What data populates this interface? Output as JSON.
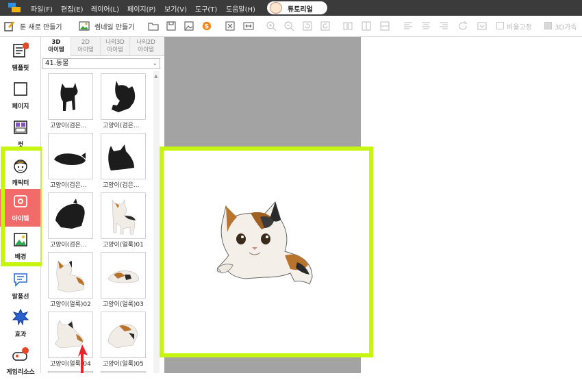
{
  "menubar": {
    "items": [
      "파일(F)",
      "편집(E)",
      "레이어(L)",
      "페이지(P)",
      "보기(V)",
      "도구(T)",
      "도움말(H)"
    ],
    "tutorial_label": "튜토리얼"
  },
  "toolbar": {
    "new_label": "툰 새로 만들기",
    "thumbnail_label": "썸네일 만들기",
    "ratio_lock_label": "비율고정",
    "accel_3d_label": "3D가속"
  },
  "leftnav": {
    "items": [
      {
        "label": "템플릿",
        "icon": "template-icon"
      },
      {
        "label": "페이지",
        "icon": "page-icon"
      },
      {
        "label": "컷",
        "icon": "cut-icon"
      },
      {
        "label": "캐릭터",
        "icon": "character-icon"
      },
      {
        "label": "아이템",
        "icon": "item-icon"
      },
      {
        "label": "배경",
        "icon": "background-icon"
      },
      {
        "label": "말풍선",
        "icon": "speech-bubble-icon"
      },
      {
        "label": "효과",
        "icon": "effect-icon"
      },
      {
        "label": "게임리소스",
        "icon": "game-resource-icon"
      }
    ],
    "active": "아이템",
    "highlight_color": "#c6f510",
    "active_color": "#f26b6b"
  },
  "panel": {
    "tabs": [
      {
        "line1": "3D",
        "line2": "아이템"
      },
      {
        "line1": "2D",
        "line2": "아이템"
      },
      {
        "line1": "나의3D",
        "line2": "아이템"
      },
      {
        "line1": "나의2D",
        "line2": "아이템"
      }
    ],
    "category": "41.동물",
    "items": [
      {
        "caption": "고양이(검은..."
      },
      {
        "caption": "고양이(검은..."
      },
      {
        "caption": "고양이(검은..."
      },
      {
        "caption": "고양이(검은..."
      },
      {
        "caption": "고양이(검은..."
      },
      {
        "caption": "고양이(얼룩)01"
      },
      {
        "caption": "고양이(얼룩)02"
      },
      {
        "caption": "고양이(얼룩)03"
      },
      {
        "caption": "고양이(얼룩)04"
      },
      {
        "caption": "고양이(얼룩)05"
      }
    ]
  }
}
